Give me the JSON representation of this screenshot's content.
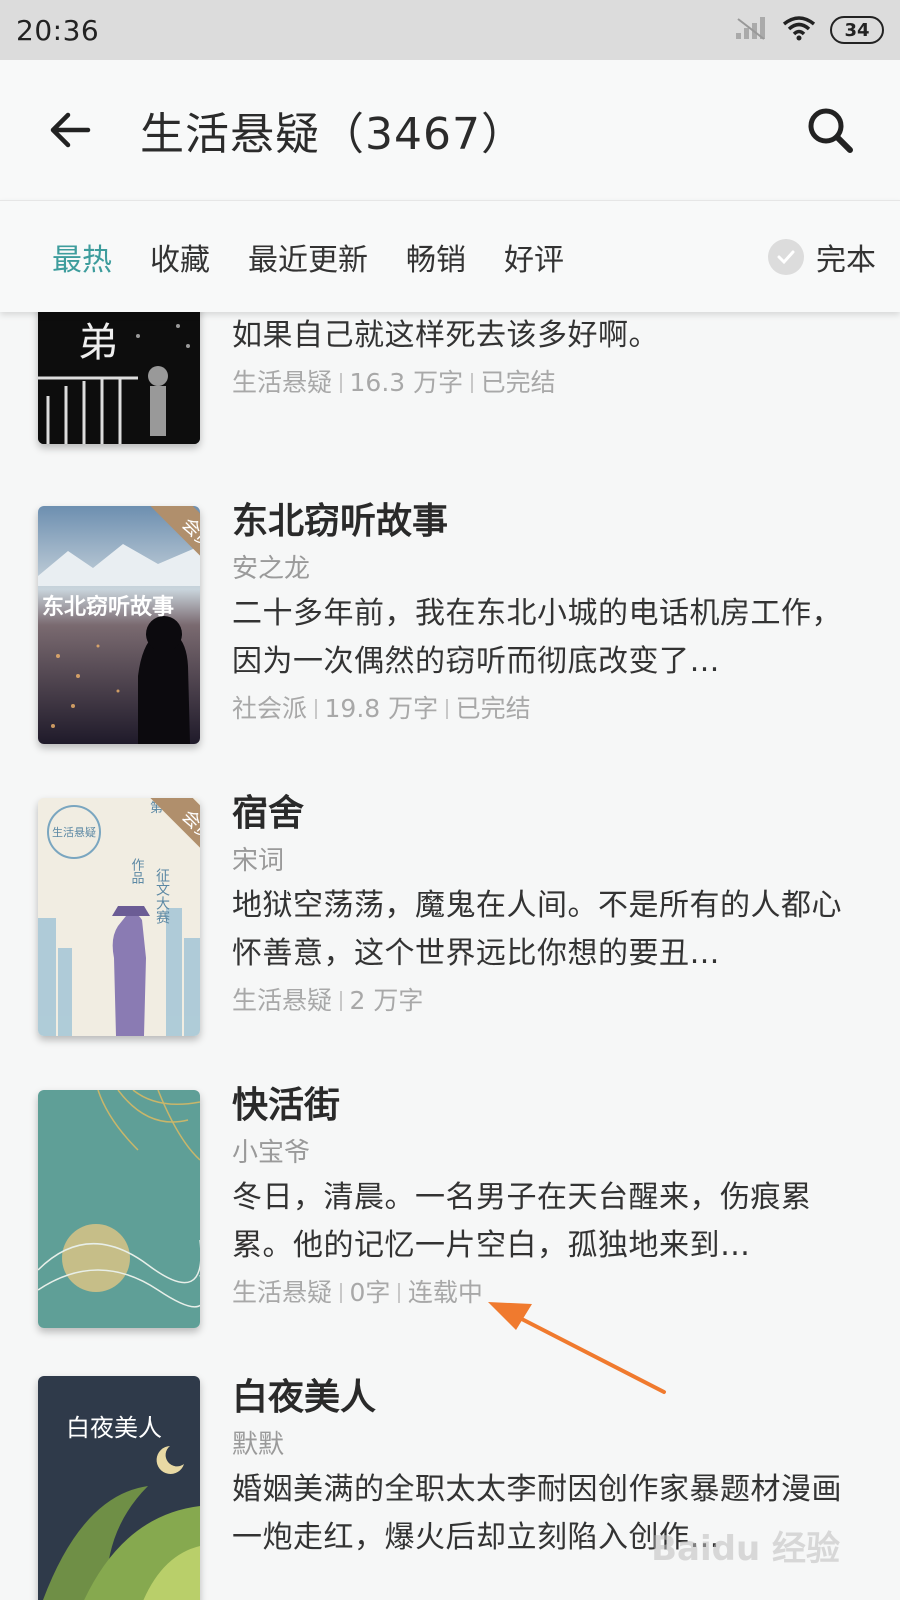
{
  "status_bar": {
    "time": "20:36",
    "battery": "34"
  },
  "app_bar": {
    "title": "生活悬疑（3467）"
  },
  "filters": {
    "tabs": [
      "最热",
      "收藏",
      "最近更新",
      "畅销",
      "好评"
    ],
    "active_tab": "最热",
    "complete_label": "完本"
  },
  "books": [
    {
      "title": "",
      "author": "",
      "desc": "从窗口跌落之时，陈诺慢慢闭上眼睛，她想，如果自己就这样死去该多好啊。",
      "meta": [
        "生活悬疑",
        "16.3 万字",
        "已完结"
      ],
      "vip": false
    },
    {
      "title": "东北窃听故事",
      "author": "安之龙",
      "desc": "二十多年前，我在东北小城的电话机房工作，因为一次偶然的窃听而彻底改变了…",
      "meta": [
        "社会派",
        "19.8 万字",
        "已完结"
      ],
      "vip": true,
      "vip_label": "会员",
      "cover_text": "东北窃听故事"
    },
    {
      "title": "宿舍",
      "author": "宋词",
      "desc": "地狱空荡荡，魔鬼在人间。不是所有的人都心怀善意，这个世界远比你想的要丑…",
      "meta": [
        "生活悬疑",
        "2 万字"
      ],
      "vip": true,
      "vip_label": "会员",
      "cover_text": "生活悬疑",
      "cover_text2": "征文大赛"
    },
    {
      "title": "快活街",
      "author": "小宝爷",
      "desc": "冬日，清晨。一名男子在天台醒来，伤痕累累。他的记忆一片空白，孤独地来到…",
      "meta": [
        "生活悬疑",
        "0字",
        "连载中"
      ],
      "vip": false
    },
    {
      "title": "白夜美人",
      "author": "默默",
      "desc": "婚姻美满的全职太太李耐因创作家暴题材漫画一炮走红，爆火后却立刻陷入创作…",
      "meta": [],
      "vip": false,
      "cover_text": "白夜美人"
    }
  ],
  "watermark": "Baidu 经验",
  "colors": {
    "accent": "#3e9d9d",
    "annotation_arrow": "#f07a2e",
    "vip_ribbon": "#b08f6c"
  }
}
